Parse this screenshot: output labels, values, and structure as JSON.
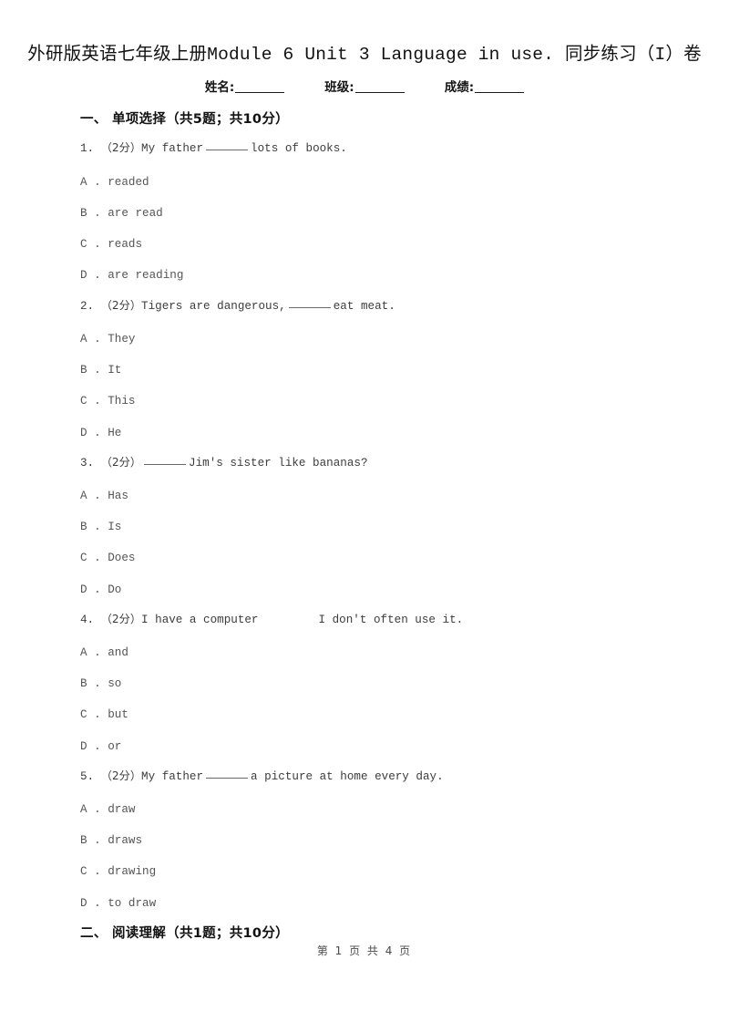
{
  "document": {
    "title": "外研版英语七年级上册Module 6 Unit 3 Language in use. 同步练习（I）卷",
    "info_line": {
      "name_label": "姓名:",
      "class_label": "班级:",
      "score_label": "成绩:"
    },
    "footer": "第 1 页 共 4 页"
  },
  "sections": [
    {
      "heading": "一、 单项选择（共5题；共10分）",
      "questions": [
        {
          "number": "1.",
          "points": "（2分）",
          "text_before": "My father",
          "blank": true,
          "text_after": "lots of books.",
          "options": [
            {
              "letter": "A",
              "sep": " . ",
              "text": "readed"
            },
            {
              "letter": "B",
              "sep": " . ",
              "text": "are read"
            },
            {
              "letter": "C",
              "sep": " . ",
              "text": "reads"
            },
            {
              "letter": "D",
              "sep": " . ",
              "text": "are reading"
            }
          ]
        },
        {
          "number": "2.",
          "points": "（2分）",
          "text_before": "Tigers are dangerous,",
          "blank": true,
          "text_after": "eat meat.",
          "options": [
            {
              "letter": "A",
              "sep": " . ",
              "text": "They"
            },
            {
              "letter": "B",
              "sep": " . ",
              "text": "It"
            },
            {
              "letter": "C",
              "sep": " . ",
              "text": "This"
            },
            {
              "letter": "D",
              "sep": " . ",
              "text": "He"
            }
          ]
        },
        {
          "number": "3.",
          "points": "（2分）",
          "text_before": "",
          "blank": true,
          "text_after": "Jim's sister like bananas?",
          "options": [
            {
              "letter": "A",
              "sep": " . ",
              "text": "Has"
            },
            {
              "letter": "B",
              "sep": " . ",
              "text": "Is"
            },
            {
              "letter": "C",
              "sep": " . ",
              "text": "Does"
            },
            {
              "letter": "D",
              "sep": " . ",
              "text": "Do"
            }
          ]
        },
        {
          "number": "4.",
          "points": "（2分）",
          "text_before": "I have a computer",
          "blank": false,
          "text_after": "I don't often use it.",
          "options": [
            {
              "letter": "A",
              "sep": " . ",
              "text": "and"
            },
            {
              "letter": "B",
              "sep": " . ",
              "text": "so"
            },
            {
              "letter": "C",
              "sep": " . ",
              "text": "but"
            },
            {
              "letter": "D",
              "sep": " . ",
              "text": "or"
            }
          ]
        },
        {
          "number": "5.",
          "points": "（2分）",
          "text_before": "My father",
          "blank": true,
          "text_after": "a picture at home every day.",
          "options": [
            {
              "letter": "A",
              "sep": " . ",
              "text": "draw"
            },
            {
              "letter": "B",
              "sep": " . ",
              "text": "draws"
            },
            {
              "letter": "C",
              "sep": " . ",
              "text": "drawing"
            },
            {
              "letter": "D",
              "sep": " . ",
              "text": "to draw"
            }
          ]
        }
      ]
    },
    {
      "heading": "二、 阅读理解（共1题；共10分）",
      "questions": []
    }
  ]
}
